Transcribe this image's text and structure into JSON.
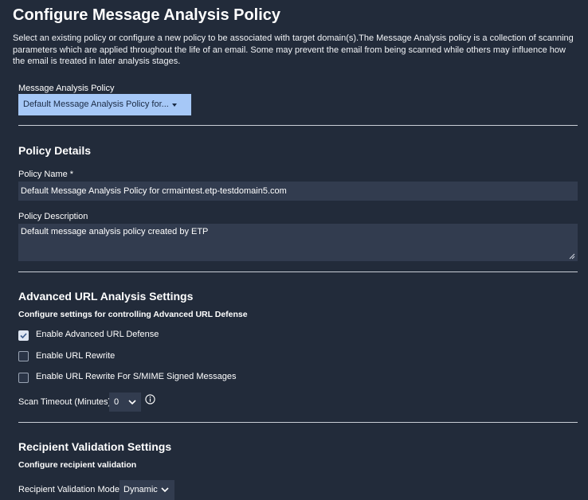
{
  "page": {
    "title": "Configure Message Analysis Policy",
    "intro": "Select an existing policy or configure a new policy to be associated with target domain(s).The Message Analysis policy is a collection of scanning parameters which are applied throughout the life of an email. Some may prevent the email from being scanned while others may influence how the email is treated in later analysis stages."
  },
  "policy_select": {
    "label": "Message Analysis Policy",
    "value": "Default Message Analysis Policy for..."
  },
  "policy_details": {
    "heading": "Policy Details",
    "name_label": "Policy Name *",
    "name_value": "Default Message Analysis Policy for crmaintest.etp-testdomain5.com",
    "description_label": "Policy Description",
    "description_value": "Default message analysis policy created by ETP"
  },
  "url_analysis": {
    "heading": "Advanced URL Analysis Settings",
    "subheading": "Configure settings for controlling Advanced URL Defense",
    "options": [
      {
        "label": "Enable Advanced URL Defense",
        "checked": true
      },
      {
        "label": "Enable URL Rewrite",
        "checked": false
      },
      {
        "label": "Enable URL Rewrite For S/MIME Signed Messages",
        "checked": false
      }
    ],
    "scan_timeout_label": "Scan Timeout (Minutes)",
    "scan_timeout_value": "0"
  },
  "recipient_validation": {
    "heading": "Recipient Validation Settings",
    "subheading": "Configure recipient validation",
    "mode_label": "Recipient Validation Mode",
    "mode_value": "Dynamic"
  },
  "icons": {
    "checkmark": "check-icon",
    "chevron": "chevron-down-icon",
    "info": "info-icon",
    "resize": "resize-handle-icon"
  },
  "colors": {
    "background": "#222b3a",
    "field": "#323c4f",
    "select_highlight": "#a6c8f7"
  }
}
